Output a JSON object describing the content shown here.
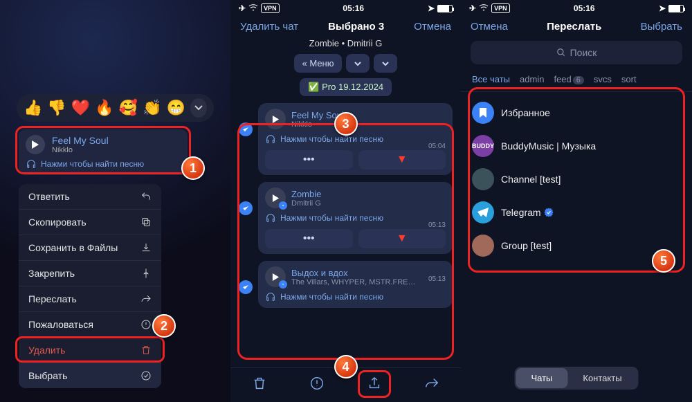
{
  "status": {
    "vpn": "VPN",
    "time": "05:16"
  },
  "panel1": {
    "reactions": [
      "👍",
      "👎",
      "❤️",
      "🔥",
      "🥰",
      "👏",
      "😁"
    ],
    "song": {
      "title": "Feel My Soul",
      "artist": "Nikklo",
      "hint": "Нажми чтобы найти песню"
    },
    "menu": {
      "reply": "Ответить",
      "copy": "Скопировать",
      "savefiles": "Сохранить в Файлы",
      "pin": "Закрепить",
      "forward": "Переслать",
      "report": "Пожаловаться",
      "delete": "Удалить",
      "select": "Выбрать"
    }
  },
  "panel2": {
    "nav": {
      "delete": "Удалить чат",
      "title": "Выбрано 3",
      "cancel": "Отмена"
    },
    "subhead": "Zombie • Dmitrii G",
    "chips": {
      "menu": "« Меню"
    },
    "pro": "Pro 19.12.2024",
    "msgs": [
      {
        "title": "Feel My Soul",
        "artist": "Nikklo",
        "hint": "Нажми чтобы найти песню",
        "time": "05:04",
        "dl": false
      },
      {
        "title": "Zombie",
        "artist": "Dmitrii G",
        "hint": "Нажми чтобы найти песню",
        "time": "05:13",
        "dl": true
      },
      {
        "title": "Выдох и вдох",
        "artist": "The Villars, WHYPER, MSTR.FREI, Jax D",
        "hint": "Нажми чтобы найти песню",
        "time": "05:13",
        "dl": true
      }
    ]
  },
  "panel3": {
    "nav": {
      "cancel": "Отмена",
      "title": "Переслать",
      "select": "Выбрать"
    },
    "search": "Поиск",
    "tabs": {
      "all": "Все чаты",
      "t2": "admin",
      "t3": "feed",
      "t3c": "6",
      "t4": "svcs",
      "t5": "sort"
    },
    "chats": [
      {
        "name": "Избранное"
      },
      {
        "name": "BuddyMusic | Музыка"
      },
      {
        "name": "Channel [test]"
      },
      {
        "name": "Telegram"
      },
      {
        "name": "Group [test]"
      }
    ],
    "segment": {
      "chats": "Чаты",
      "contacts": "Контакты"
    }
  }
}
